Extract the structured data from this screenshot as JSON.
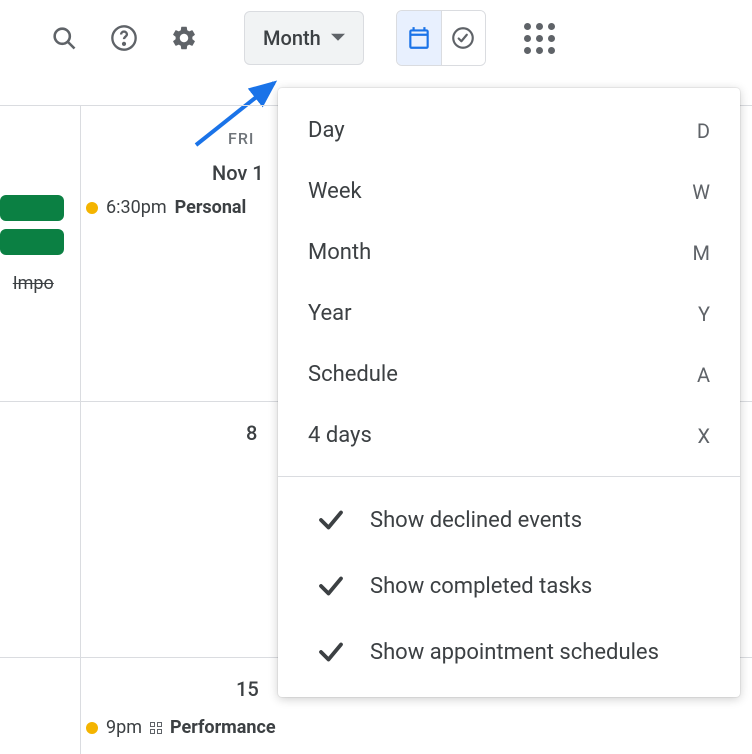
{
  "toolbar": {
    "view_label": "Month"
  },
  "dropdown": {
    "items": [
      {
        "label": "Day",
        "shortcut": "D"
      },
      {
        "label": "Week",
        "shortcut": "W"
      },
      {
        "label": "Month",
        "shortcut": "M"
      },
      {
        "label": "Year",
        "shortcut": "Y"
      },
      {
        "label": "Schedule",
        "shortcut": "A"
      },
      {
        "label": "4 days",
        "shortcut": "X"
      }
    ],
    "checks": [
      {
        "label": "Show declined events"
      },
      {
        "label": "Show completed tasks"
      },
      {
        "label": "Show appointment schedules"
      }
    ]
  },
  "calendar": {
    "day_header": "FRI",
    "dates": {
      "r0": "Nov 1",
      "r1": "8",
      "r2": "15"
    },
    "events": {
      "e1_time": "6:30pm",
      "e1_title": "Personal",
      "e2_title": "Impo",
      "e3_time": "9pm",
      "e3_title": "Performance"
    }
  }
}
